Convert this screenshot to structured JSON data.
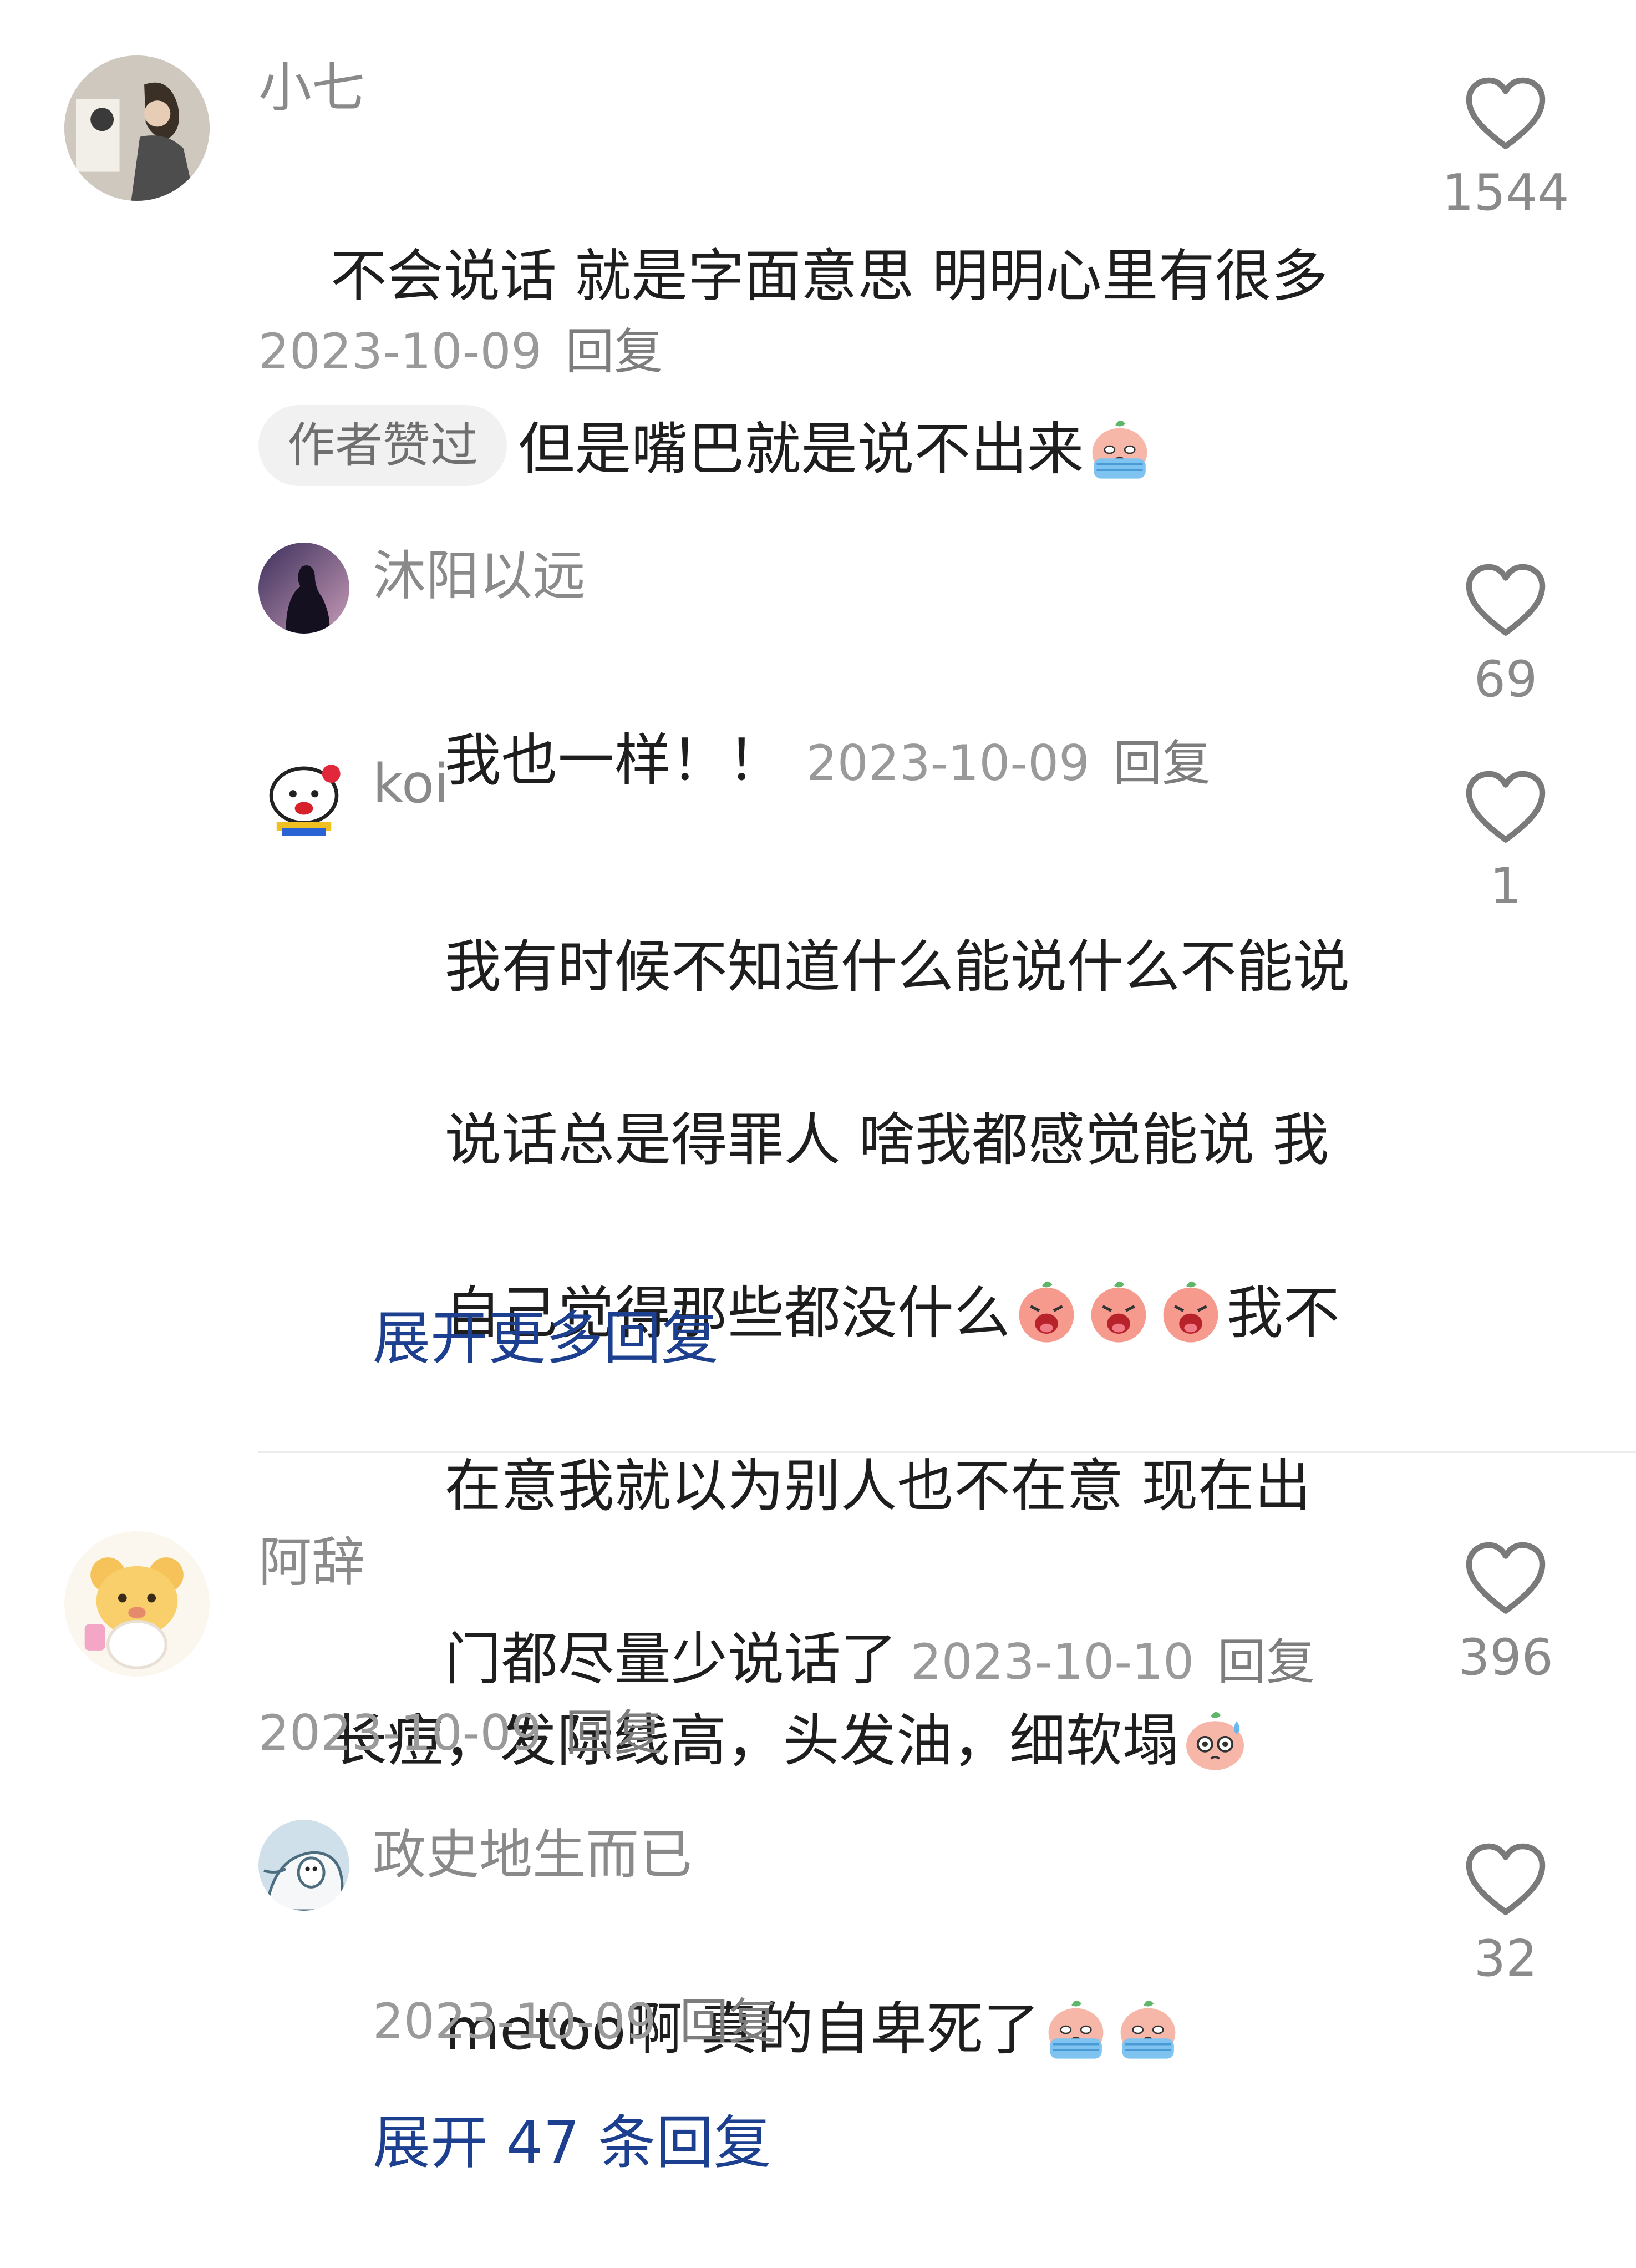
{
  "comments": [
    {
      "username": "小七",
      "text_line1": "不会说话 就是字面意思 明明心里有很多",
      "text_line2": "话想说 但是嘴巴就是说不出来",
      "emoji": "crying-emoji",
      "date": "2023-10-09",
      "reply_label": "回复",
      "author_badge": "作者赞过",
      "likes": "1544",
      "replies": [
        {
          "username": "沐阳以远",
          "text": "我也一样！！",
          "date": "2023-10-09",
          "reply_label": "回复",
          "likes": "69"
        },
        {
          "username": "koi",
          "text_line1": "我有时候不知道什么能说什么不能说",
          "text_line2": "说话总是得罪人 啥我都感觉能说 我",
          "text_line3a": "自己觉得那些都没什么",
          "text_line3b": "我不",
          "text_line4": "在意我就以为别人也不在意 现在出",
          "text_line5": "门都尽量少说话了",
          "emoji": "screaming-emoji",
          "date": "2023-10-10",
          "reply_label": "回复",
          "likes": "1"
        }
      ],
      "expand_label": "展开更多回复"
    },
    {
      "username": "阿辞",
      "text": "长痘，发际线高，头发油，细软塌",
      "emoji": "sweating-emoji",
      "date": "2023-10-09",
      "reply_label": "回复",
      "likes": "396",
      "replies": [
        {
          "username": "政史地生而已",
          "text": "metoo啊 真的自卑死了",
          "emoji": "crying-emoji",
          "date": "2023-10-09",
          "reply_label": "回复",
          "likes": "32"
        }
      ],
      "expand_label": "展开 47 条回复"
    }
  ],
  "colors": {
    "expand_link": "#1c3f8f",
    "username": "#8a8a8a",
    "meta": "#9a9a9a"
  },
  "icons": {
    "like": "heart-outline-icon"
  }
}
